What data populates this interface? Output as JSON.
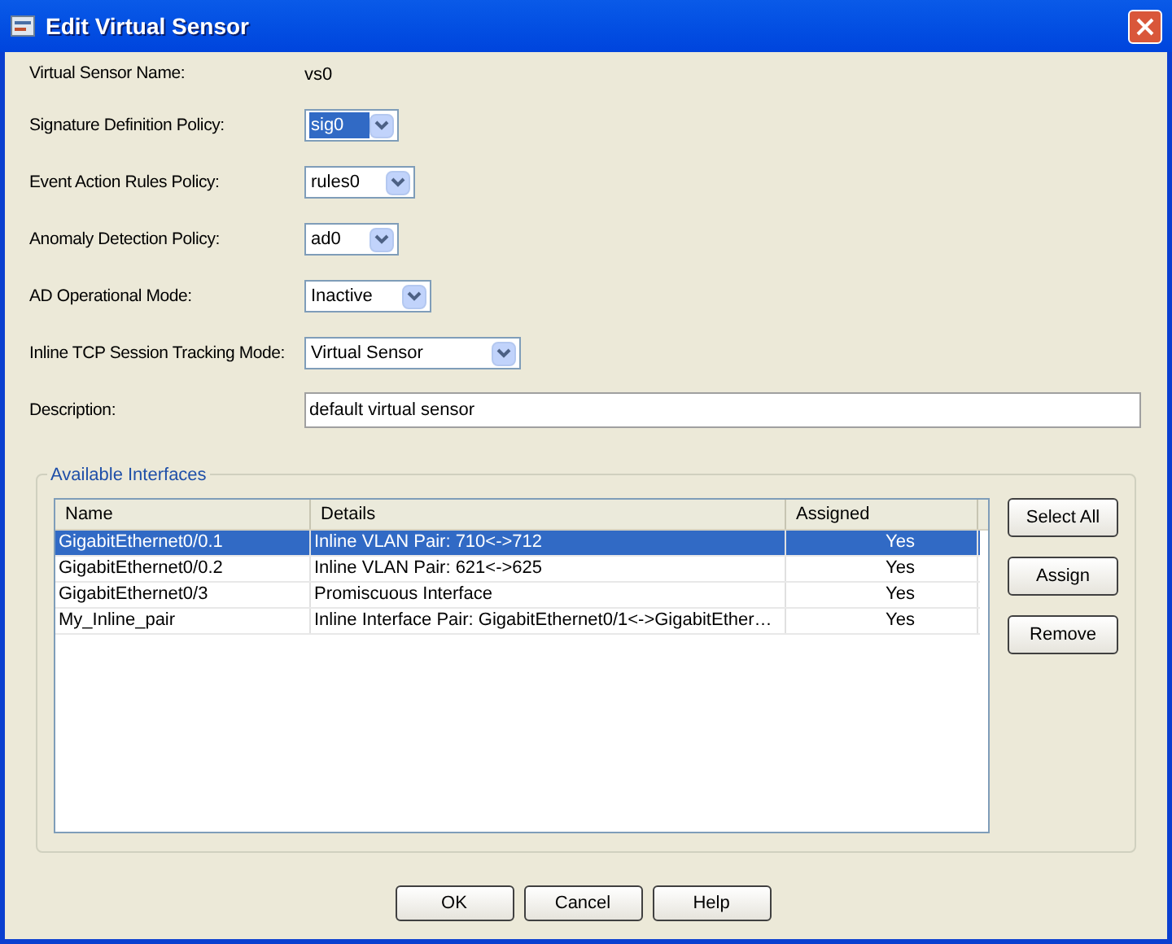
{
  "window": {
    "title": "Edit Virtual Sensor"
  },
  "fields": [
    {
      "kind": "text",
      "label": "Virtual Sensor Name:",
      "value": "vs0"
    },
    {
      "kind": "select",
      "label": "Signature Definition Policy:",
      "value": "sig0",
      "focused": true
    },
    {
      "kind": "select",
      "label": "Event Action Rules Policy:",
      "value": "rules0",
      "focused": false
    },
    {
      "kind": "select",
      "label": "Anomaly Detection Policy:",
      "value": "ad0",
      "focused": false
    },
    {
      "kind": "select",
      "label": "AD Operational Mode:",
      "value": "Inactive",
      "focused": false
    },
    {
      "kind": "select",
      "label": "Inline TCP Session Tracking Mode:",
      "value": "Virtual Sensor",
      "focused": false
    },
    {
      "kind": "input",
      "label": "Description:",
      "value": "default virtual sensor"
    }
  ],
  "interfaces": {
    "title": "Available Interfaces",
    "table": {
      "columns": [
        "Name",
        "Details",
        "Assigned"
      ],
      "rows": [
        {
          "cells": [
            "GigabitEthernet0/0.1",
            "Inline VLAN Pair: 710<->712",
            "Yes"
          ],
          "selected": true
        },
        {
          "cells": [
            "GigabitEthernet0/0.2",
            "Inline VLAN Pair: 621<->625",
            "Yes"
          ],
          "selected": false
        },
        {
          "cells": [
            "GigabitEthernet0/3",
            "Promiscuous Interface",
            "Yes"
          ],
          "selected": false
        },
        {
          "cells": [
            "My_Inline_pair",
            "Inline Interface Pair: GigabitEthernet0/1<->GigabitEther…",
            "Yes"
          ],
          "selected": false
        }
      ]
    },
    "buttons": [
      "Select All",
      "Assign",
      "Remove"
    ]
  },
  "buttons": [
    "OK",
    "Cancel",
    "Help"
  ]
}
